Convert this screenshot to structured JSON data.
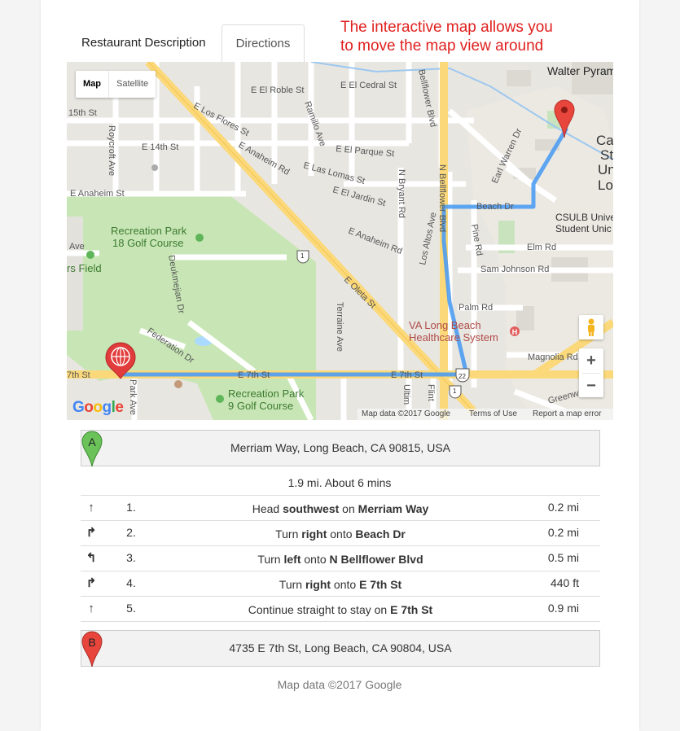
{
  "tabs": {
    "description": "Restaurant Description",
    "directions": "Directions"
  },
  "annotation": {
    "line1": "The interactive map allows you",
    "line2": "to move the map view around"
  },
  "map": {
    "type_map": "Map",
    "type_satellite": "Satellite",
    "zoom_in": "+",
    "zoom_out": "−",
    "google_logo": "Google",
    "footer_data": "Map data ©2017 Google",
    "footer_terms": "Terms of Use",
    "footer_report": "Report a map error",
    "labels": {
      "walter_pyramid": "Walter Pyramid",
      "cedral": "E El Cedral St",
      "robles": "E El Roble St",
      "flores": "E Los Flores St",
      "ramillo": "Ramillo Ave",
      "bellflower_top": "Bellflower Blvd",
      "st15": "15th St",
      "royc": "Roycroft Ave",
      "e14": "E 14th St",
      "anaheim_rd": "E Anaheim Rd",
      "parque": "E El Parque St",
      "lomas": "E Las Lomas St",
      "jardin": "E El Jardin St",
      "warren": "Earl Warren Dr",
      "anaheim_st": "E Anaheim St",
      "rec18_1": "Recreation Park",
      "rec18_2": "18 Golf Course",
      "fields": "rs Field",
      "deukm": "Deukmejian Dr",
      "anaheim_e": "E Anaheim Rd",
      "nbryant": "N Bryant Rd",
      "losaltos": "Los Altos Ave",
      "nbellflower": "N Bellflower Blvd",
      "pine": "Pine Rd",
      "beachdr": "Beach Dr",
      "csulb1": "CSULB Universi",
      "csulb2": "Student Unic",
      "elm": "Elm Rd",
      "samjohnson": "Sam Johnson Rd",
      "oleta": "E Oleta St",
      "palm": "Palm Rd",
      "va1": "VA Long Beach",
      "va2": "Healthcare System",
      "federation": "Federation Dr",
      "terraine": "Terraine Ave",
      "magnolia": "Magnolia Rd",
      "e7th_1": "E 7th St",
      "e7th_2": "E 7th St",
      "st7": "7th St",
      "park": "Park Ave",
      "rec9_1": "Recreation Park",
      "rec9_2": "9 Golf Course",
      "ultim": "Ultim",
      "flint": "Flint",
      "greenway": "Greenway Dr",
      "cali1": "Cali",
      "cali2": "St",
      "cali3": "Univ",
      "cali4": "Long",
      "ave": "Ave",
      "route1a": "1",
      "route1b": "1",
      "route22": "22"
    }
  },
  "start": {
    "marker": "A",
    "address": "Merriam Way, Long Beach, CA 90815, USA"
  },
  "summary": "1.9 mi. About 6 mins",
  "steps": [
    {
      "icon": "straight-arrow-icon",
      "num": "1.",
      "pre": "Head ",
      "b1": "southwest",
      "mid": " on ",
      "b2": "Merriam Way",
      "dist": "0.2 mi"
    },
    {
      "icon": "turn-right-icon",
      "num": "2.",
      "pre": "Turn ",
      "b1": "right",
      "mid": " onto ",
      "b2": "Beach Dr",
      "dist": "0.2 mi"
    },
    {
      "icon": "turn-left-icon",
      "num": "3.",
      "pre": "Turn ",
      "b1": "left",
      "mid": " onto ",
      "b2": "N Bellflower Blvd",
      "dist": "0.5 mi"
    },
    {
      "icon": "turn-right-icon",
      "num": "4.",
      "pre": "Turn ",
      "b1": "right",
      "mid": " onto ",
      "b2": "E 7th St",
      "dist": "440 ft"
    },
    {
      "icon": "straight-arrow-icon",
      "num": "5.",
      "pre": "Continue straight to stay on ",
      "b1": "",
      "mid": "",
      "b2": "E 7th St",
      "dist": "0.9 mi"
    }
  ],
  "end": {
    "marker": "B",
    "address": "4735 E 7th St, Long Beach, CA 90804, USA"
  },
  "copyright": "Map data ©2017 Google",
  "colors": {
    "route": "#4e9cf2",
    "marker_a": "#6ac259",
    "marker_b": "#e8453c",
    "annotation": "#e0201f"
  }
}
